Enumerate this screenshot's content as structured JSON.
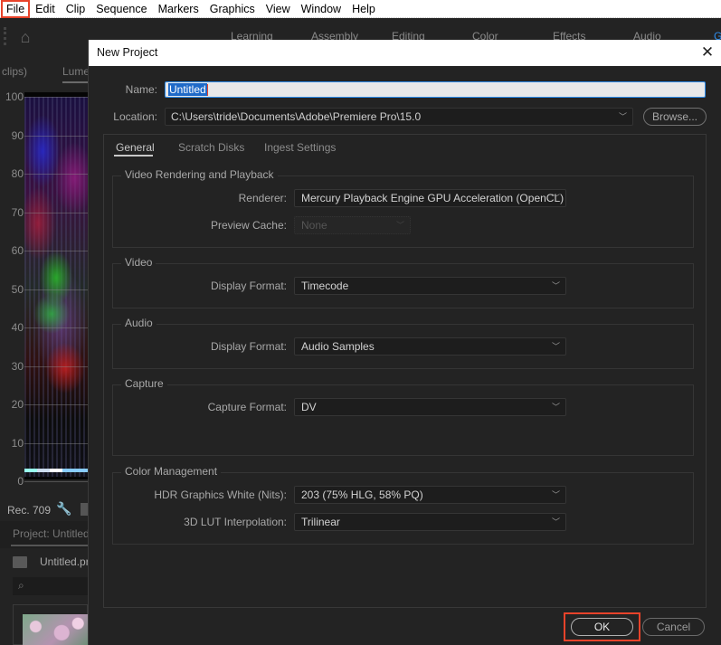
{
  "menubar": {
    "items": [
      "File",
      "Edit",
      "Clip",
      "Sequence",
      "Markers",
      "Graphics",
      "View",
      "Window",
      "Help"
    ],
    "highlighted": "File"
  },
  "workspace": {
    "tabs": [
      "Learning",
      "Assembly",
      "Editing",
      "Color",
      "Effects",
      "Audio",
      "Graphics"
    ],
    "active_tab": "Graphics"
  },
  "left_panel": {
    "header_left": "clips)",
    "header_tab": "Lume",
    "scope_labels": [
      "100",
      "90",
      "80",
      "70",
      "60",
      "50",
      "40",
      "30",
      "20",
      "10",
      "0"
    ],
    "colorspace": "Rec. 709",
    "project_title": "Project: Untitled",
    "bin_name": "Untitled.prproj"
  },
  "dialog": {
    "title": "New Project",
    "close_label": "✕",
    "name_label": "Name:",
    "name_value": "Untitled",
    "location_label": "Location:",
    "location_value": "C:\\Users\\tride\\Documents\\Adobe\\Premiere Pro\\15.0",
    "browse_label": "Browse...",
    "tabs": [
      "General",
      "Scratch Disks",
      "Ingest Settings"
    ],
    "active_tab": "General",
    "groups": {
      "video_rendering": {
        "title": "Video Rendering and Playback",
        "renderer_label": "Renderer:",
        "renderer_value": "Mercury Playback Engine GPU Acceleration (OpenCL)",
        "preview_cache_label": "Preview Cache:",
        "preview_cache_value": "None"
      },
      "video": {
        "title": "Video",
        "display_format_label": "Display Format:",
        "display_format_value": "Timecode"
      },
      "audio": {
        "title": "Audio",
        "display_format_label": "Display Format:",
        "display_format_value": "Audio Samples"
      },
      "capture": {
        "title": "Capture",
        "capture_format_label": "Capture Format:",
        "capture_format_value": "DV"
      },
      "color_management": {
        "title": "Color Management",
        "hdr_label": "HDR Graphics White (Nits):",
        "hdr_value": "203 (75% HLG, 58% PQ)",
        "lut_label": "3D LUT Interpolation:",
        "lut_value": "Trilinear"
      }
    },
    "ok_label": "OK",
    "cancel_label": "Cancel"
  },
  "colors": {
    "highlight_box": "#e8432a",
    "accent_blue": "#2d8ceb",
    "dialog_bg": "#232323"
  }
}
